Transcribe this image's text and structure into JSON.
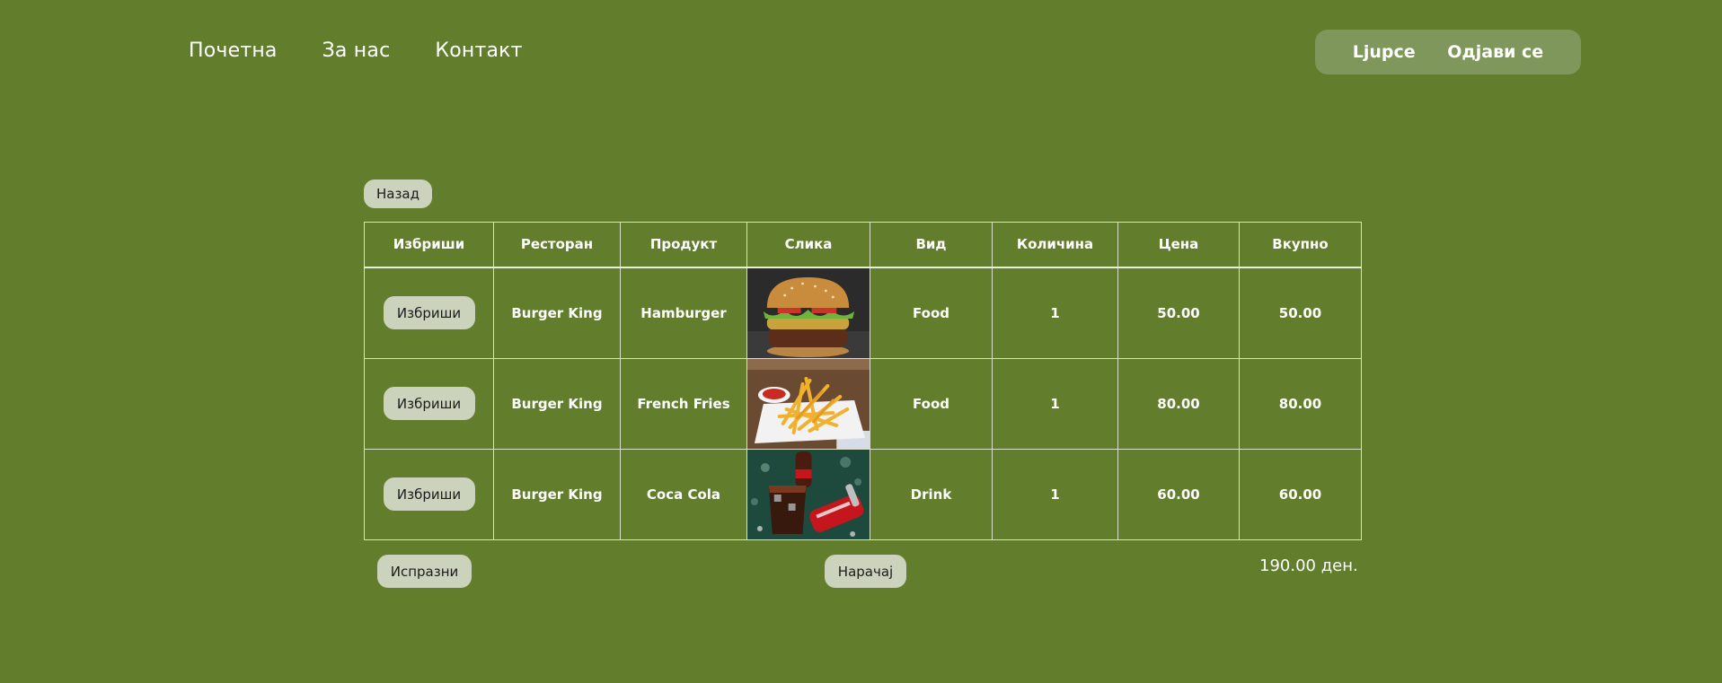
{
  "nav": {
    "links": [
      "Почетна",
      "За нас",
      "Контакт"
    ],
    "user_name": "Ljupce",
    "logout_label": "Одјави се"
  },
  "back_label": "Назад",
  "table": {
    "headers": [
      "Избриши",
      "Ресторан",
      "Продукт",
      "Слика",
      "Вид",
      "Количина",
      "Цена",
      "Вкупно"
    ],
    "rows": [
      {
        "delete_label": "Избриши",
        "restaurant": "Burger King",
        "product": "Hamburger",
        "image": "hamburger-photo",
        "type": "Food",
        "quantity": "1",
        "price": "50.00",
        "total": "50.00"
      },
      {
        "delete_label": "Избриши",
        "restaurant": "Burger King",
        "product": "French Fries",
        "image": "french-fries-photo",
        "type": "Food",
        "quantity": "1",
        "price": "80.00",
        "total": "80.00"
      },
      {
        "delete_label": "Избриши",
        "restaurant": "Burger King",
        "product": "Coca Cola",
        "image": "coca-cola-photo",
        "type": "Drink",
        "quantity": "1",
        "price": "60.00",
        "total": "60.00"
      }
    ]
  },
  "footer": {
    "clear_label": "Испразни",
    "order_label": "Нарачај",
    "grand_total": "190.00 ден."
  },
  "colors": {
    "background": "#627e2d",
    "user_pill": "#7f975a",
    "button": "#cbd3bc"
  }
}
